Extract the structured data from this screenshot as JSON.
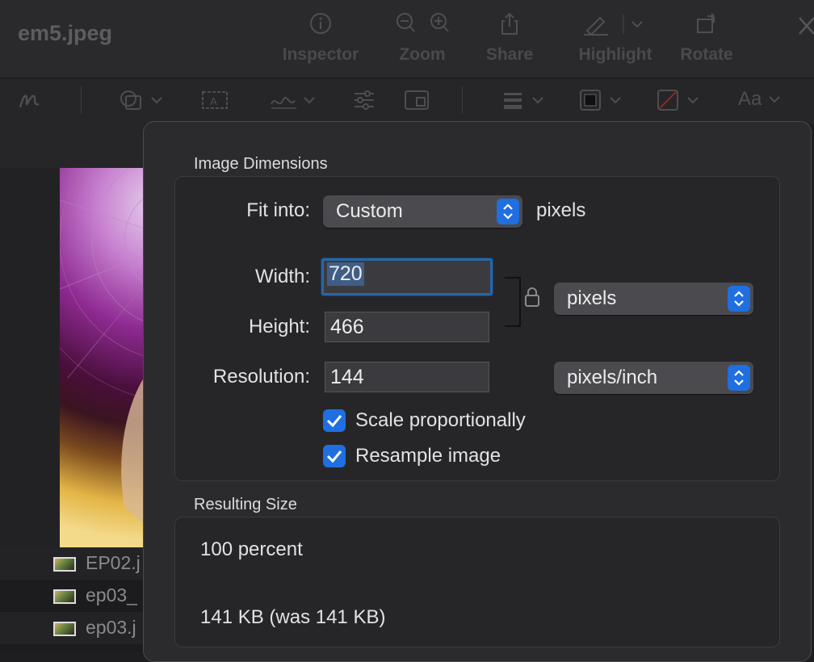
{
  "window": {
    "title": "em5.jpeg"
  },
  "toolbar": {
    "inspector": "Inspector",
    "zoom": "Zoom",
    "share": "Share",
    "highlight": "Highlight",
    "rotate": "Rotate"
  },
  "markup": {
    "font_label": "Aa"
  },
  "files": [
    {
      "name": "EP02.j"
    },
    {
      "name": "ep03_"
    },
    {
      "name": "ep03.j"
    }
  ],
  "dialog": {
    "image_dimensions_title": "Image Dimensions",
    "fit_into_label": "Fit into:",
    "fit_into_value": "Custom",
    "fit_into_unit": "pixels",
    "width_label": "Width:",
    "width_value": "720",
    "height_label": "Height:",
    "height_value": "466",
    "size_unit": "pixels",
    "resolution_label": "Resolution:",
    "resolution_value": "144",
    "resolution_unit": "pixels/inch",
    "scale_proportionally_label": "Scale proportionally",
    "scale_proportionally_checked": true,
    "resample_label": "Resample image",
    "resample_checked": true,
    "resulting_size_title": "Resulting Size",
    "result_percent": "100 percent",
    "result_size": "141 KB (was 141 KB)"
  },
  "colors": {
    "accent": "#1f6fe0",
    "panel": "#2b2b2e",
    "focus_ring": "#2a64a6"
  }
}
